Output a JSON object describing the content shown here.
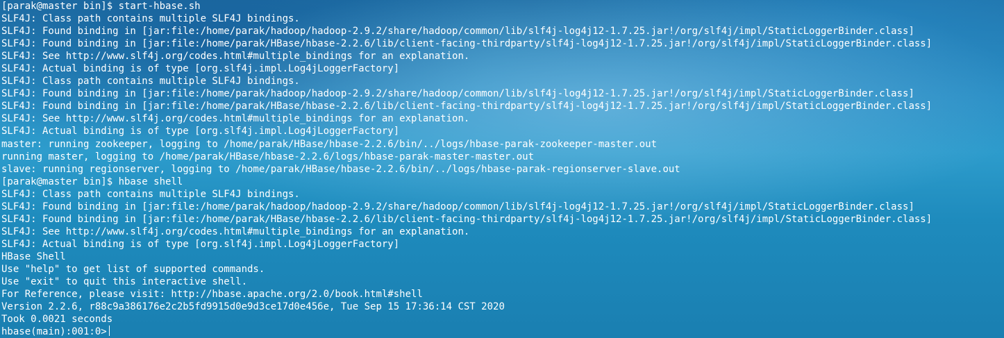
{
  "terminal": {
    "lines": [
      "[parak@master bin]$ start-hbase.sh",
      "SLF4J: Class path contains multiple SLF4J bindings.",
      "SLF4J: Found binding in [jar:file:/home/parak/hadoop/hadoop-2.9.2/share/hadoop/common/lib/slf4j-log4j12-1.7.25.jar!/org/slf4j/impl/StaticLoggerBinder.class]",
      "SLF4J: Found binding in [jar:file:/home/parak/HBase/hbase-2.2.6/lib/client-facing-thirdparty/slf4j-log4j12-1.7.25.jar!/org/slf4j/impl/StaticLoggerBinder.class]",
      "SLF4J: See http://www.slf4j.org/codes.html#multiple_bindings for an explanation.",
      "SLF4J: Actual binding is of type [org.slf4j.impl.Log4jLoggerFactory]",
      "SLF4J: Class path contains multiple SLF4J bindings.",
      "SLF4J: Found binding in [jar:file:/home/parak/hadoop/hadoop-2.9.2/share/hadoop/common/lib/slf4j-log4j12-1.7.25.jar!/org/slf4j/impl/StaticLoggerBinder.class]",
      "SLF4J: Found binding in [jar:file:/home/parak/HBase/hbase-2.2.6/lib/client-facing-thirdparty/slf4j-log4j12-1.7.25.jar!/org/slf4j/impl/StaticLoggerBinder.class]",
      "SLF4J: See http://www.slf4j.org/codes.html#multiple_bindings for an explanation.",
      "SLF4J: Actual binding is of type [org.slf4j.impl.Log4jLoggerFactory]",
      "master: running zookeeper, logging to /home/parak/HBase/hbase-2.2.6/bin/../logs/hbase-parak-zookeeper-master.out",
      "running master, logging to /home/parak/HBase/hbase-2.2.6/logs/hbase-parak-master-master.out",
      "slave: running regionserver, logging to /home/parak/HBase/hbase-2.2.6/bin/../logs/hbase-parak-regionserver-slave.out",
      "[parak@master bin]$ hbase shell",
      "SLF4J: Class path contains multiple SLF4J bindings.",
      "SLF4J: Found binding in [jar:file:/home/parak/hadoop/hadoop-2.9.2/share/hadoop/common/lib/slf4j-log4j12-1.7.25.jar!/org/slf4j/impl/StaticLoggerBinder.class]",
      "SLF4J: Found binding in [jar:file:/home/parak/HBase/hbase-2.2.6/lib/client-facing-thirdparty/slf4j-log4j12-1.7.25.jar!/org/slf4j/impl/StaticLoggerBinder.class]",
      "SLF4J: See http://www.slf4j.org/codes.html#multiple_bindings for an explanation.",
      "SLF4J: Actual binding is of type [org.slf4j.impl.Log4jLoggerFactory]",
      "HBase Shell",
      "Use \"help\" to get list of supported commands.",
      "Use \"exit\" to quit this interactive shell.",
      "For Reference, please visit: http://hbase.apache.org/2.0/book.html#shell",
      "Version 2.2.6, r88c9a386176e2c2b5fd9915d0e9d3ce17d0e456e, Tue Sep 15 17:36:14 CST 2020",
      "Took 0.0021 seconds"
    ],
    "prompt": "hbase(main):001:0>"
  }
}
